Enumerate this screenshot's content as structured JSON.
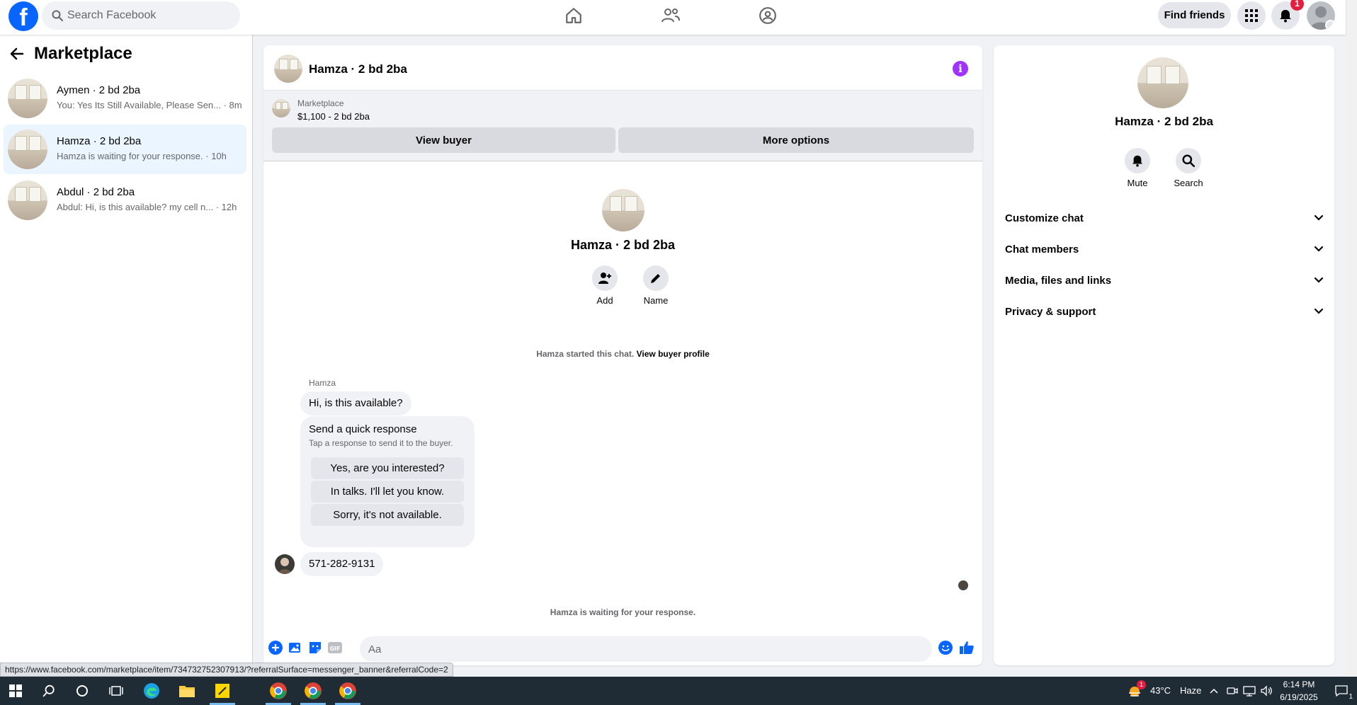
{
  "colors": {
    "brand": "#0866ff",
    "accent_purple": "#a033ff",
    "badge_red": "#e41e3f",
    "active_row": "#ebf5ff"
  },
  "topbar": {
    "logo_letter": "f",
    "search_placeholder": "Search Facebook",
    "find_friends_label": "Find friends",
    "notification_count": "1",
    "icons": [
      "home-icon",
      "friends-icon",
      "groups-icon",
      "apps-grid-icon",
      "bell-icon"
    ]
  },
  "marketplace": {
    "title": "Marketplace",
    "conversations": [
      {
        "name": "Aymen · 2 bd 2ba",
        "snippet": "You: Yes Its Still Available, Please Sen... · 8m",
        "active": false
      },
      {
        "name": "Hamza · 2 bd 2ba",
        "snippet": "Hamza is waiting for your response. · 10h",
        "active": true
      },
      {
        "name": "Abdul · 2 bd 2ba",
        "snippet": "Abdul: Hi, is this available? my cell n... · 12h",
        "active": false
      }
    ]
  },
  "chat": {
    "header_name": "Hamza · 2 bd 2ba",
    "info_glyph": "i",
    "listing": {
      "label": "Marketplace",
      "price_title": "$1,100 - 2 bd 2ba"
    },
    "view_buyer_label": "View buyer",
    "more_options_label": "More options",
    "intro_name": "Hamza · 2 bd 2ba",
    "actions": {
      "add": "Add",
      "name": "Name"
    },
    "started_text": "Hamza started this chat.",
    "view_profile_link": "View buyer profile",
    "sender": "Hamza",
    "first_message": "Hi, is this available?",
    "quick": {
      "title": "Send a quick response",
      "subtitle": "Tap a response to send it to the buyer.",
      "options": [
        "Yes, are you interested?",
        "In talks. I'll let you know.",
        "Sorry, it's not available."
      ]
    },
    "phone_message": "571-282-9131",
    "waiting_text": "Hamza is waiting for your response.",
    "composer_placeholder": "Aa"
  },
  "info_panel": {
    "name": "Hamza · 2 bd 2ba",
    "actions": {
      "mute": "Mute",
      "search": "Search"
    },
    "sections": [
      "Customize chat",
      "Chat members",
      "Media, files and links",
      "Privacy & support"
    ]
  },
  "status_url": "https://www.facebook.com/marketplace/item/734732752307913/?referralSurface=messenger_banner&referralCode=2",
  "taskbar": {
    "weather_temp": "43°C",
    "weather_desc": "Haze",
    "weather_badge": "1",
    "time": "6:14 PM",
    "date": "6/19/2025",
    "notification_count": "1"
  }
}
